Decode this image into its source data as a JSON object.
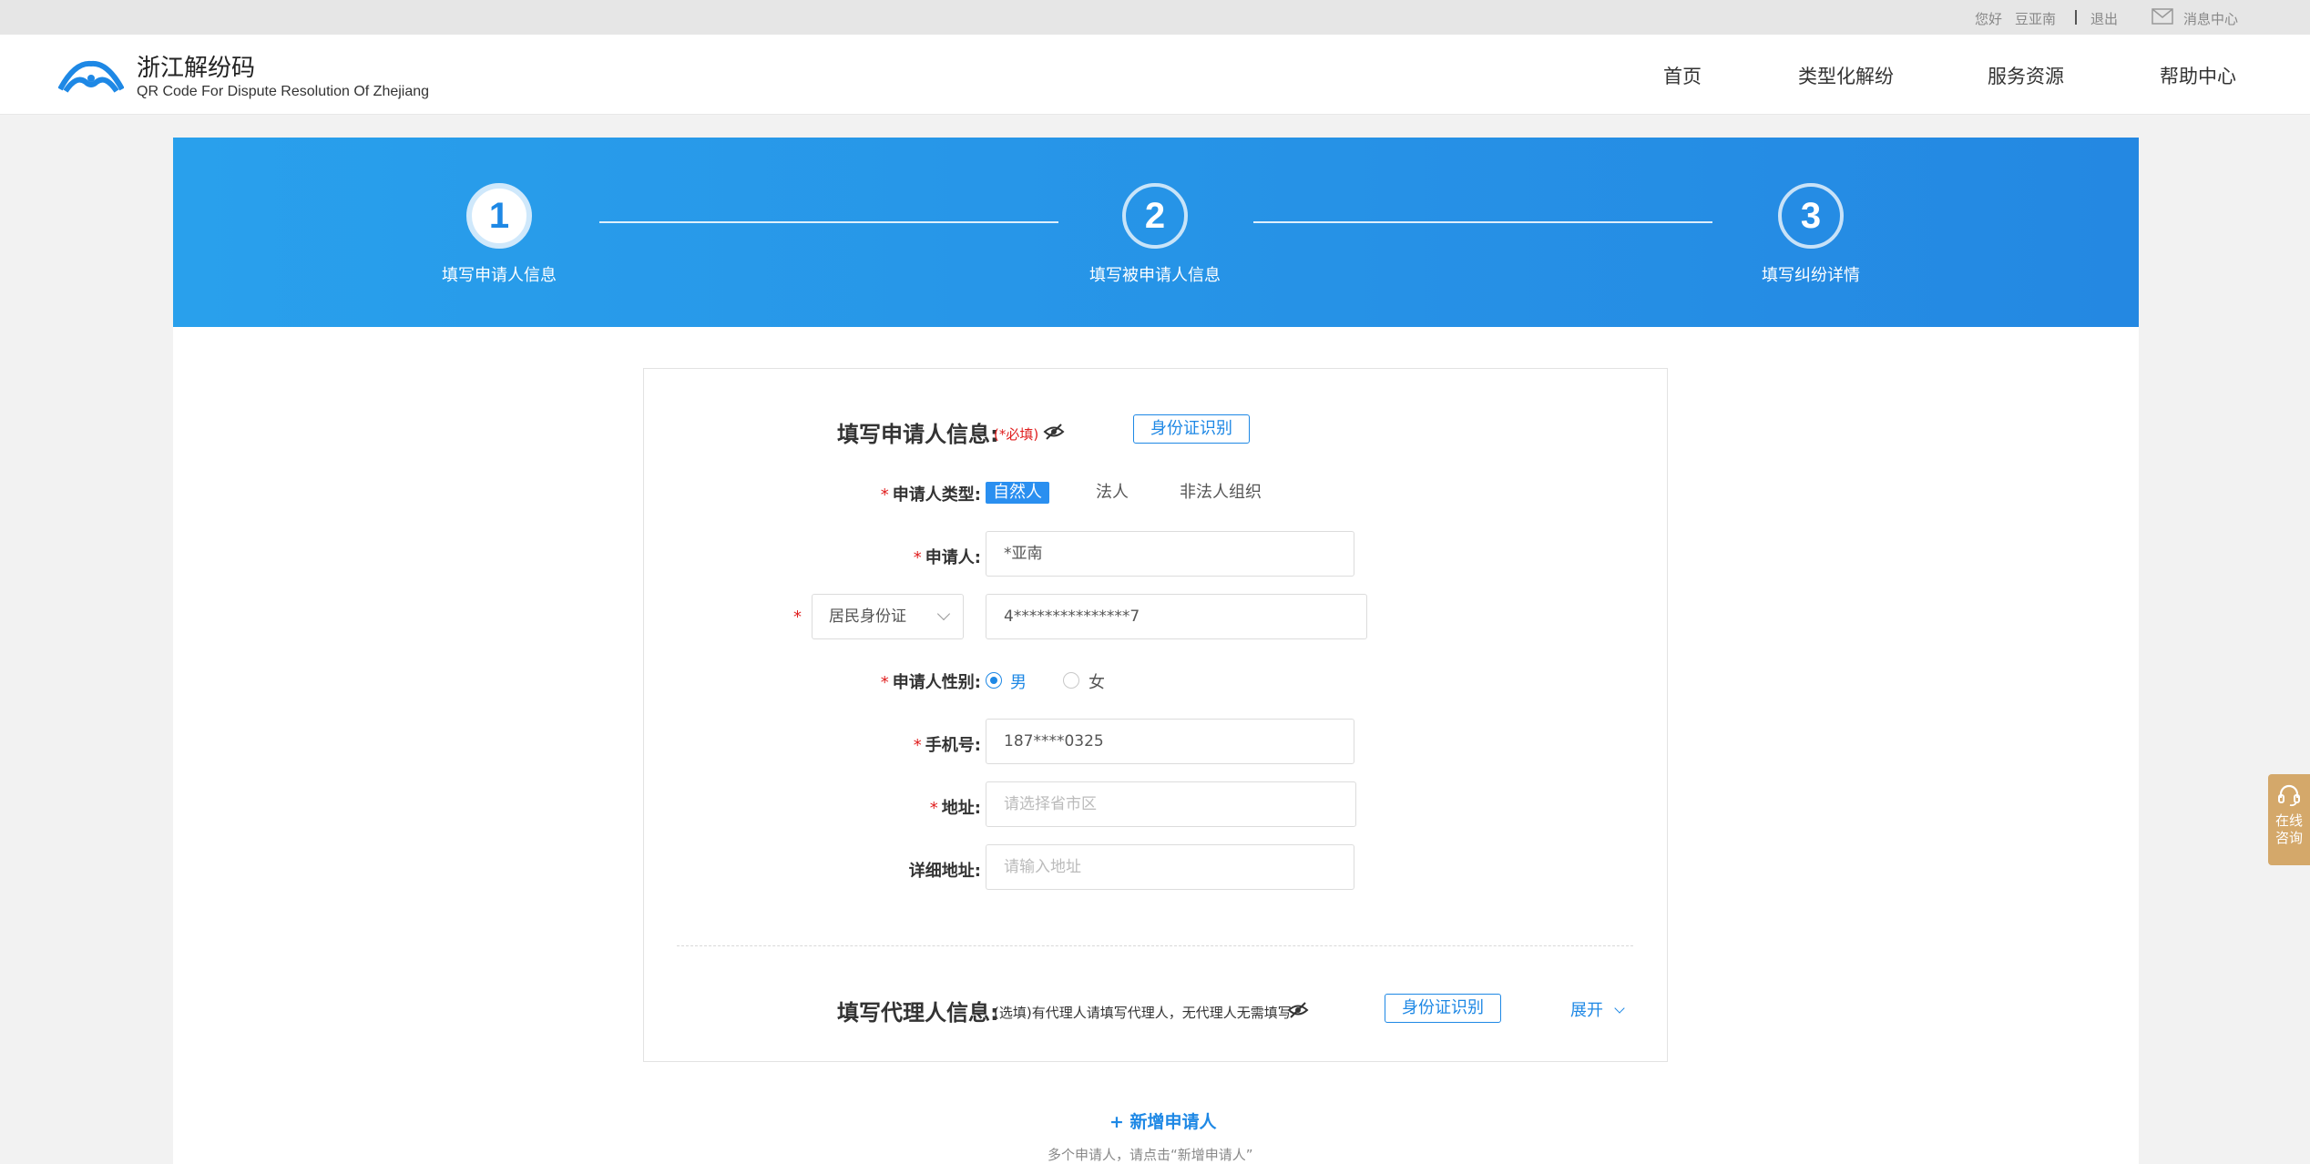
{
  "topbar": {
    "greeting": "您好",
    "username": "豆亚南",
    "logout": "退出",
    "messages": "消息中心"
  },
  "header": {
    "title": "浙江解纷码",
    "subtitle": "QR Code For Dispute Resolution Of Zhejiang",
    "nav": [
      "首页",
      "类型化解纷",
      "服务资源",
      "帮助中心"
    ]
  },
  "steps": [
    {
      "num": "1",
      "label": "填写申请人信息",
      "active": true
    },
    {
      "num": "2",
      "label": "填写被申请人信息",
      "active": false
    },
    {
      "num": "3",
      "label": "填写纠纷详情",
      "active": false
    }
  ],
  "applicant": {
    "title": "填写申请人信息:",
    "required_note": "(*必填)",
    "ocr_button": "身份证识别",
    "type_label": "申请人类型:",
    "type_options": [
      "自然人",
      "法人",
      "非法人组织"
    ],
    "name_label": "申请人:",
    "name_value": "*亚南",
    "id_type": "居民身份证",
    "id_value": "4***************7",
    "gender_label": "申请人性别:",
    "gender_male": "男",
    "gender_female": "女",
    "phone_label": "手机号:",
    "phone_value": "187****0325",
    "address_label": "地址:",
    "address_placeholder": "请选择省市区",
    "detail_label": "详细地址:",
    "detail_placeholder": "请输入地址"
  },
  "agent": {
    "title": "填写代理人信息:",
    "note": "(选填)有代理人请填写代理人，无代理人无需填写",
    "ocr_button": "身份证识别",
    "expand": "展开"
  },
  "add_applicant": {
    "link": "+ 新增申请人",
    "hint": "多个申请人，请点击“新增申请人”"
  },
  "side_widget": {
    "line1": "在线",
    "line2": "咨询"
  },
  "colors": {
    "primary": "#1e88e5",
    "required": "#e02020",
    "side_widget": "#d4a86a"
  }
}
